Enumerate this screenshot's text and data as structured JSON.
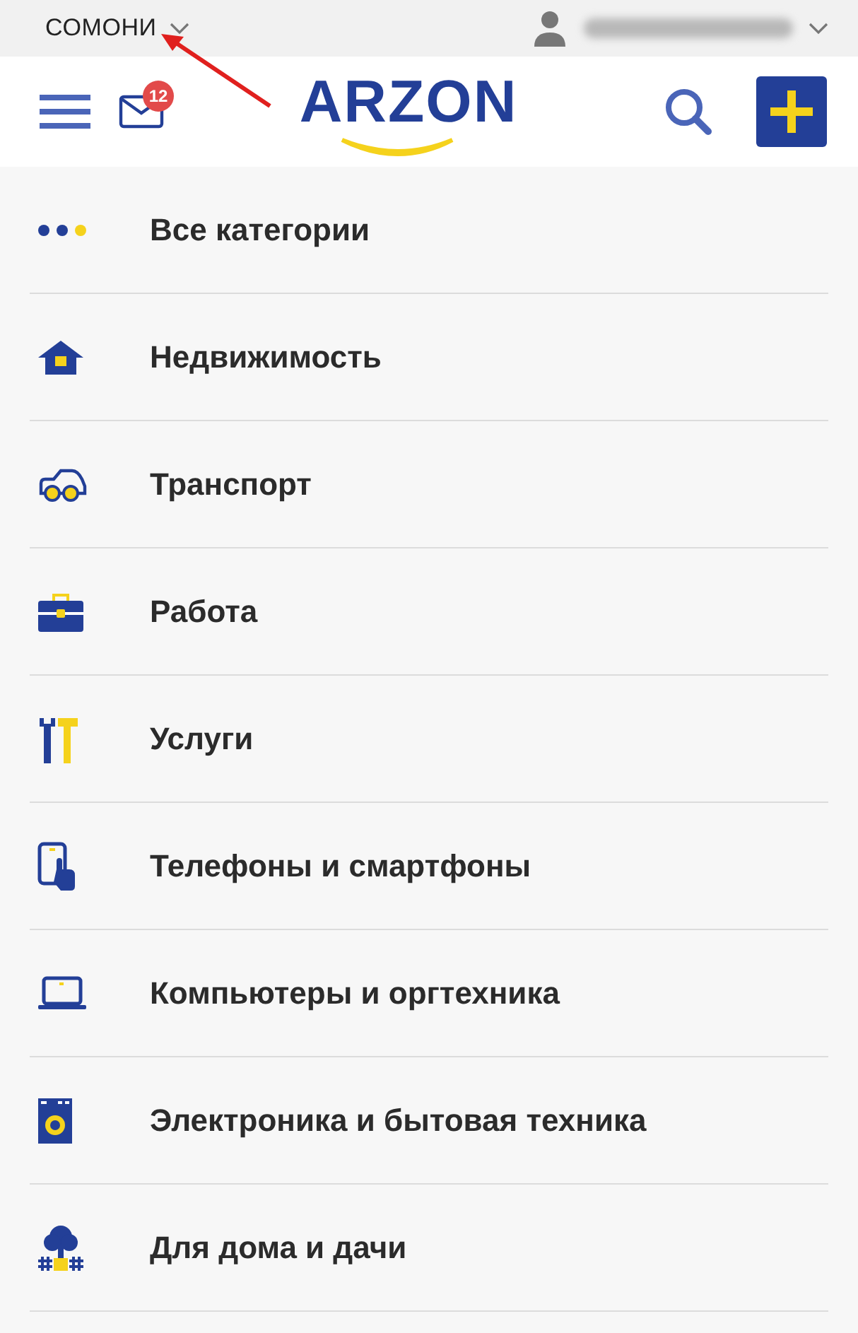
{
  "top_bar": {
    "currency": "СОМОНИ"
  },
  "header": {
    "unread_messages": "12",
    "logo": "ARZON"
  },
  "categories": [
    {
      "label": "Все категории"
    },
    {
      "label": "Недвижимость"
    },
    {
      "label": "Транспорт"
    },
    {
      "label": "Работа"
    },
    {
      "label": "Услуги"
    },
    {
      "label": "Телефоны и смартфоны"
    },
    {
      "label": "Компьютеры и оргтехника"
    },
    {
      "label": "Электроника и бытовая техника"
    },
    {
      "label": "Для дома и дачи"
    }
  ]
}
